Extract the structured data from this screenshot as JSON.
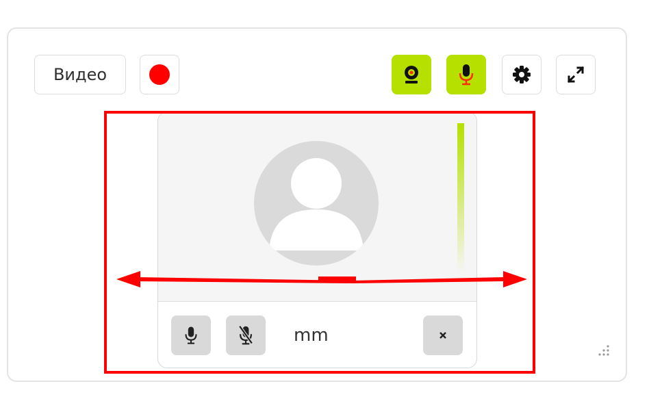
{
  "toolbar": {
    "video_label": "Видео",
    "record_icon": "record-icon",
    "camera_icon": "webcam-icon",
    "mic_icon": "microphone-icon",
    "settings_icon": "gear-icon",
    "fullscreen_icon": "expand-icon",
    "active_color": "#b6e000",
    "record_color": "#ff0000"
  },
  "tile": {
    "user_name": "mm",
    "avatar_icon": "user-avatar-icon",
    "mic_icon": "microphone-icon",
    "mute_icon": "microphone-off-icon",
    "close_icon": "close-icon",
    "volume_level": 0.95
  },
  "annotation": {
    "color": "#ff0000",
    "arrow_icon": "double-arrow-horizontal-icon"
  }
}
